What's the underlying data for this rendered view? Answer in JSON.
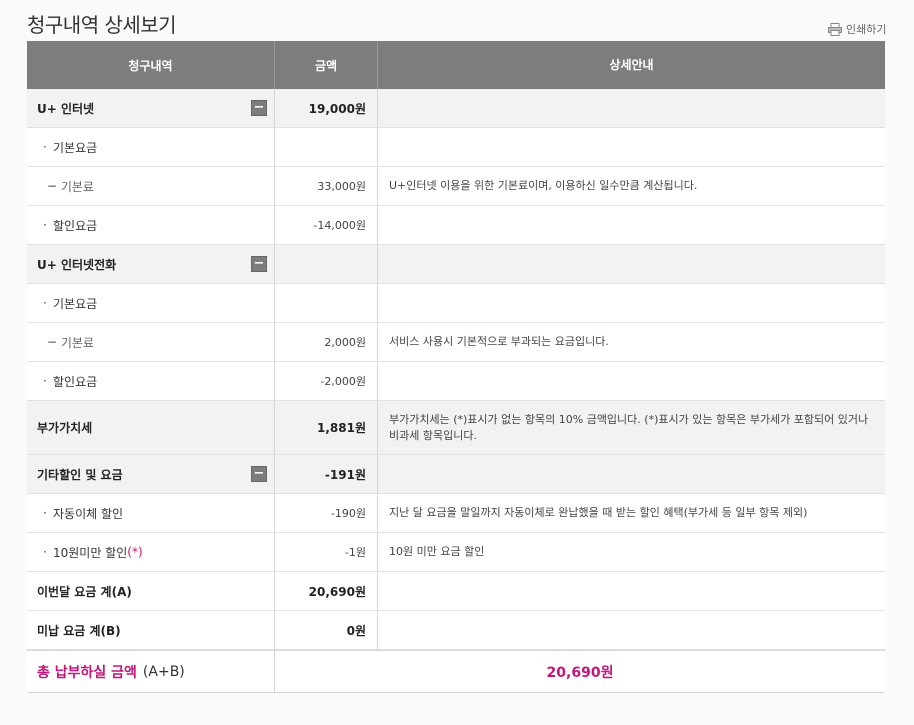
{
  "page": {
    "title": "청구내역 상세보기",
    "print_label": "인쇄하기"
  },
  "colors": {
    "accent": "#c3167a",
    "header_bg": "#7d7d7d",
    "section_bg": "#f2f2f2"
  },
  "table": {
    "headers": [
      "청구내역",
      "금액",
      "상세안내"
    ],
    "internet": {
      "label": "U+ 인터넷",
      "amount": "19,000원",
      "basic_fee_group": "기본요금",
      "basic_fee_item": "기본료",
      "basic_fee_amount": "33,000원",
      "basic_fee_desc": "U+인터넷 이용을 위한 기본료이며, 이용하신 일수만큼 계산됩니다.",
      "discount_label": "할인요금",
      "discount_amount": "-14,000원"
    },
    "phone": {
      "label": "U+ 인터넷전화",
      "basic_fee_group": "기본요금",
      "basic_fee_item": "기본료",
      "basic_fee_amount": "2,000원",
      "basic_fee_desc": "서비스 사용시 기본적으로 부과되는 요금입니다.",
      "discount_label": "할인요금",
      "discount_amount": "-2,000원"
    },
    "vat": {
      "label": "부가가치세",
      "amount": "1,881원",
      "desc": "부가가치세는 (*)표시가 없는 항목의 10% 금액입니다. (*)표시가 있는 항목은 부가세가 포함되어 있거나 비과세 항목입니다."
    },
    "etc": {
      "label": "기타할인 및 요금",
      "amount": "-191원",
      "autopay_label": "자동이체 할인",
      "autopay_amount": "-190원",
      "autopay_desc": "지난 달 요금을 말일까지 자동이체로 완납했을 때 받는 할인 혜택(부가세 등 일부 항목 제외)",
      "under10_label": "10원미만 할인",
      "under10_mark": "(*)",
      "under10_amount": "-1원",
      "under10_desc": "10원 미만 요금 할인"
    },
    "month_total": {
      "label": "이번달 요금 계(A)",
      "amount": "20,690원"
    },
    "unpaid": {
      "label": "미납 요금 계(B)",
      "amount": "0원"
    },
    "grand": {
      "label": "총 납부하실 금액",
      "label_suffix": "(A+B)",
      "amount": "20,690원"
    },
    "collapse_symbol": "−",
    "bullet": "·",
    "dash": "−"
  }
}
